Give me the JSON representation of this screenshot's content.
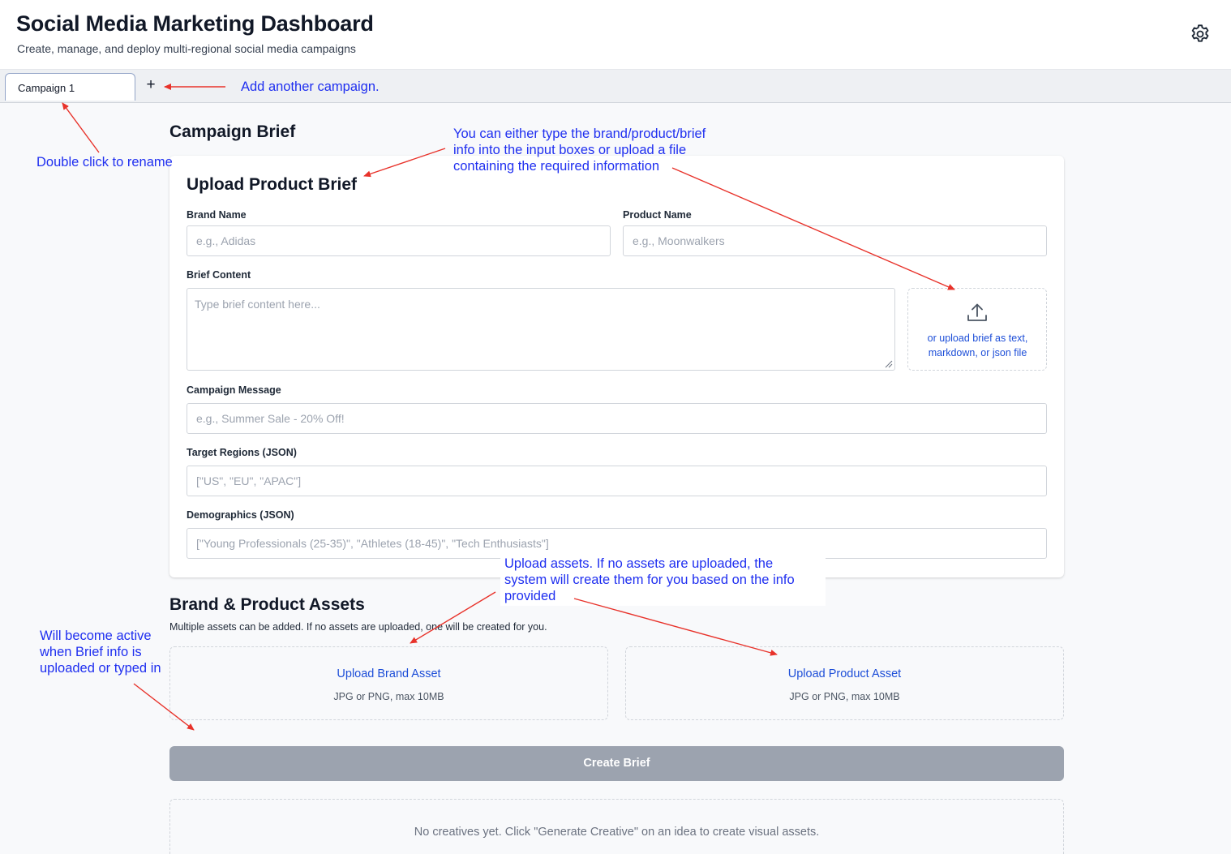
{
  "header": {
    "title": "Social Media Marketing Dashboard",
    "subtitle": "Create, manage, and deploy multi-regional social media campaigns",
    "settings_icon": "gear-icon"
  },
  "tabs": {
    "items": [
      {
        "label": "Campaign 1"
      }
    ],
    "add_label": "+"
  },
  "annotations": {
    "add_campaign": "Add another campaign.",
    "rename": "Double click to rename",
    "brief_line1": "You can either type the brand/product/brief",
    "brief_line2": "info into the input boxes or upload a file",
    "brief_line3": "containing the required information",
    "assets_line1": "Upload assets.  If no assets are uploaded, the",
    "assets_line2": "system will create them for you based on the info",
    "assets_line3": "provided",
    "active_line1": "Will become active",
    "active_line2": "when Brief info is",
    "active_line3": "uploaded or typed in",
    "color": "#1f2ff0",
    "arrow_color": "#e8322a"
  },
  "brief": {
    "section_title": "Campaign Brief",
    "card_title": "Upload Product Brief",
    "brand_name": {
      "label": "Brand Name",
      "placeholder": "e.g., Adidas"
    },
    "product_name": {
      "label": "Product Name",
      "placeholder": "e.g., Moonwalkers"
    },
    "brief_content": {
      "label": "Brief Content",
      "placeholder": "Type brief content here..."
    },
    "upload": {
      "icon": "upload-icon",
      "line1": "or upload brief as text,",
      "line2": "markdown, or json file"
    },
    "campaign_message": {
      "label": "Campaign Message",
      "placeholder": "e.g., Summer Sale - 20% Off!"
    },
    "target_regions": {
      "label": "Target Regions (JSON)",
      "placeholder": "[\"US\", \"EU\", \"APAC\"]"
    },
    "demographics": {
      "label": "Demographics (JSON)",
      "placeholder": "[\"Young Professionals (25-35)\", \"Athletes (18-45)\", \"Tech Enthusiasts\"]"
    }
  },
  "assets": {
    "section_title": "Brand & Product Assets",
    "description": "Multiple assets can be added. If no assets are uploaded, one will be created for you.",
    "brand": {
      "title": "Upload Brand Asset",
      "subtitle": "JPG or PNG, max 10MB"
    },
    "product": {
      "title": "Upload Product Asset",
      "subtitle": "JPG or PNG, max 10MB"
    }
  },
  "actions": {
    "create_brief": "Create Brief",
    "create_brief_state": "disabled"
  },
  "creatives": {
    "empty_text": "No creatives yet. Click \"Generate Creative\" on an idea to create visual assets."
  },
  "colors": {
    "accent": "#1d4ed8",
    "disabled_button": "#9ca3af",
    "background": "#f8f9fb"
  }
}
